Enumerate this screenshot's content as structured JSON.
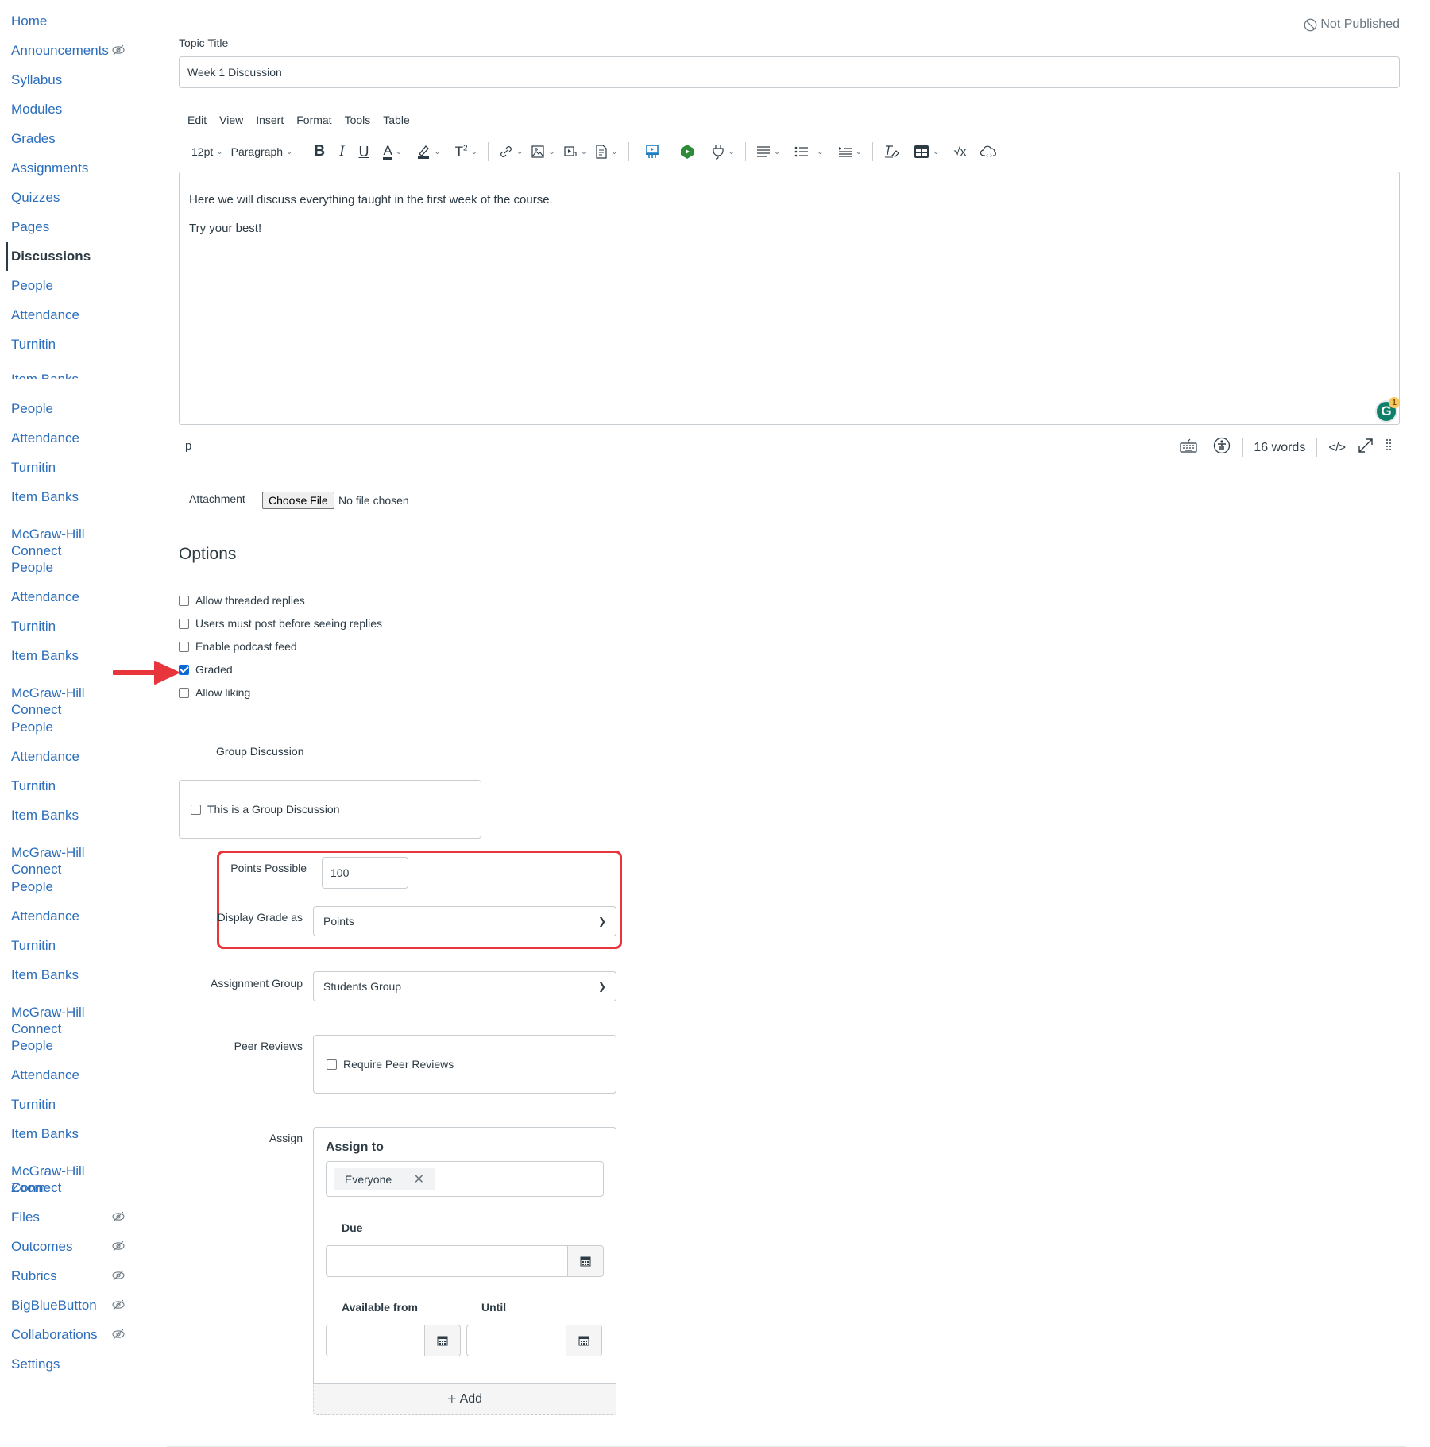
{
  "sidebar": {
    "items": [
      {
        "label": "Home",
        "hidden": false
      },
      {
        "label": "Announcements",
        "hidden": true
      },
      {
        "label": "Syllabus",
        "hidden": false
      },
      {
        "label": "Modules",
        "hidden": false
      },
      {
        "label": "Grades",
        "hidden": false
      },
      {
        "label": "Assignments",
        "hidden": false
      },
      {
        "label": "Quizzes",
        "hidden": false
      },
      {
        "label": "Pages",
        "hidden": false
      },
      {
        "label": "Discussions",
        "hidden": false,
        "active": true
      },
      {
        "label": "People",
        "hidden": false
      },
      {
        "label": "Attendance",
        "hidden": false
      },
      {
        "label": "Turnitin",
        "hidden": false
      },
      {
        "label": "Item Banks",
        "hidden": false,
        "clipped": true
      },
      {
        "label": "People",
        "hidden": false
      },
      {
        "label": "Attendance",
        "hidden": false
      },
      {
        "label": "Turnitin",
        "hidden": false
      },
      {
        "label": "Item Banks",
        "hidden": false
      },
      {
        "label": "McGraw-Hill",
        "label2": "Connect",
        "hidden": false
      },
      {
        "label": "People",
        "hidden": false
      },
      {
        "label": "Attendance",
        "hidden": false
      },
      {
        "label": "Turnitin",
        "hidden": false
      },
      {
        "label": "Item Banks",
        "hidden": false
      },
      {
        "label": "McGraw-Hill",
        "label2": "Connect",
        "hidden": false
      },
      {
        "label": "People",
        "hidden": false
      },
      {
        "label": "Attendance",
        "hidden": false
      },
      {
        "label": "Turnitin",
        "hidden": false
      },
      {
        "label": "Item Banks",
        "hidden": false
      },
      {
        "label": "McGraw-Hill",
        "label2": "Connect",
        "hidden": false
      },
      {
        "label": "People",
        "hidden": false
      },
      {
        "label": "Attendance",
        "hidden": false
      },
      {
        "label": "Turnitin",
        "hidden": false
      },
      {
        "label": "Item Banks",
        "hidden": false
      },
      {
        "label": "McGraw-Hill",
        "label2": "Connect",
        "hidden": false
      },
      {
        "label": "People",
        "hidden": false
      },
      {
        "label": "Attendance",
        "hidden": false
      },
      {
        "label": "Turnitin",
        "hidden": false
      },
      {
        "label": "Item Banks",
        "hidden": false
      },
      {
        "label": "McGraw-Hill",
        "label2": "Connect",
        "hidden": false
      },
      {
        "label": "Zoom",
        "hidden": false
      },
      {
        "label": "Files",
        "hidden": true
      },
      {
        "label": "Outcomes",
        "hidden": true
      },
      {
        "label": "Rubrics",
        "hidden": true
      },
      {
        "label": "BigBlueButton",
        "hidden": true
      },
      {
        "label": "Collaborations",
        "hidden": true
      },
      {
        "label": "Settings",
        "hidden": false
      }
    ]
  },
  "header": {
    "publish_status": "Not Published",
    "publish_icon": "not-published-icon"
  },
  "topic": {
    "label": "Topic Title",
    "value": "Week 1 Discussion"
  },
  "editor": {
    "menu": [
      "Edit",
      "View",
      "Insert",
      "Format",
      "Tools",
      "Table"
    ],
    "font_size": "12pt",
    "block_format": "Paragraph",
    "content": [
      "Here we will discuss everything taught in the first week of the course.",
      "Try your best!"
    ],
    "path": "p",
    "word_count": "16 words",
    "html_toggle": "</>",
    "grammarly_count": "1",
    "grammarly_letter": "G"
  },
  "attachment": {
    "label": "Attachment",
    "button": "Choose File",
    "status": "No file chosen"
  },
  "options": {
    "heading": "Options",
    "checkboxes": [
      {
        "label": "Allow threaded replies",
        "checked": false
      },
      {
        "label": "Users must post before seeing replies",
        "checked": false
      },
      {
        "label": "Enable podcast feed",
        "checked": false
      },
      {
        "label": "Graded",
        "checked": true
      },
      {
        "label": "Allow liking",
        "checked": false
      }
    ]
  },
  "group_discussion": {
    "label": "Group Discussion",
    "checkbox_label": "This is a Group Discussion",
    "checked": false
  },
  "grading": {
    "points_label": "Points Possible",
    "points_value": "100",
    "display_label": "Display Grade as",
    "display_value": "Points",
    "assignment_group_label": "Assignment Group",
    "assignment_group_value": "Students Group",
    "peer_reviews_label": "Peer Reviews",
    "peer_reviews_checkbox": "Require Peer Reviews",
    "peer_reviews_checked": false
  },
  "assign": {
    "label": "Assign",
    "assign_to_label": "Assign to",
    "assignees": [
      "Everyone"
    ],
    "due_label": "Due",
    "due_value": "",
    "available_from_label": "Available from",
    "available_from_value": "",
    "until_label": "Until",
    "until_value": "",
    "add_label": "Add"
  },
  "colors": {
    "link": "#2b6ebc",
    "text": "#2d3b45",
    "annotation_red": "#e8353c",
    "checkbox_checked": "#0b68d6"
  }
}
